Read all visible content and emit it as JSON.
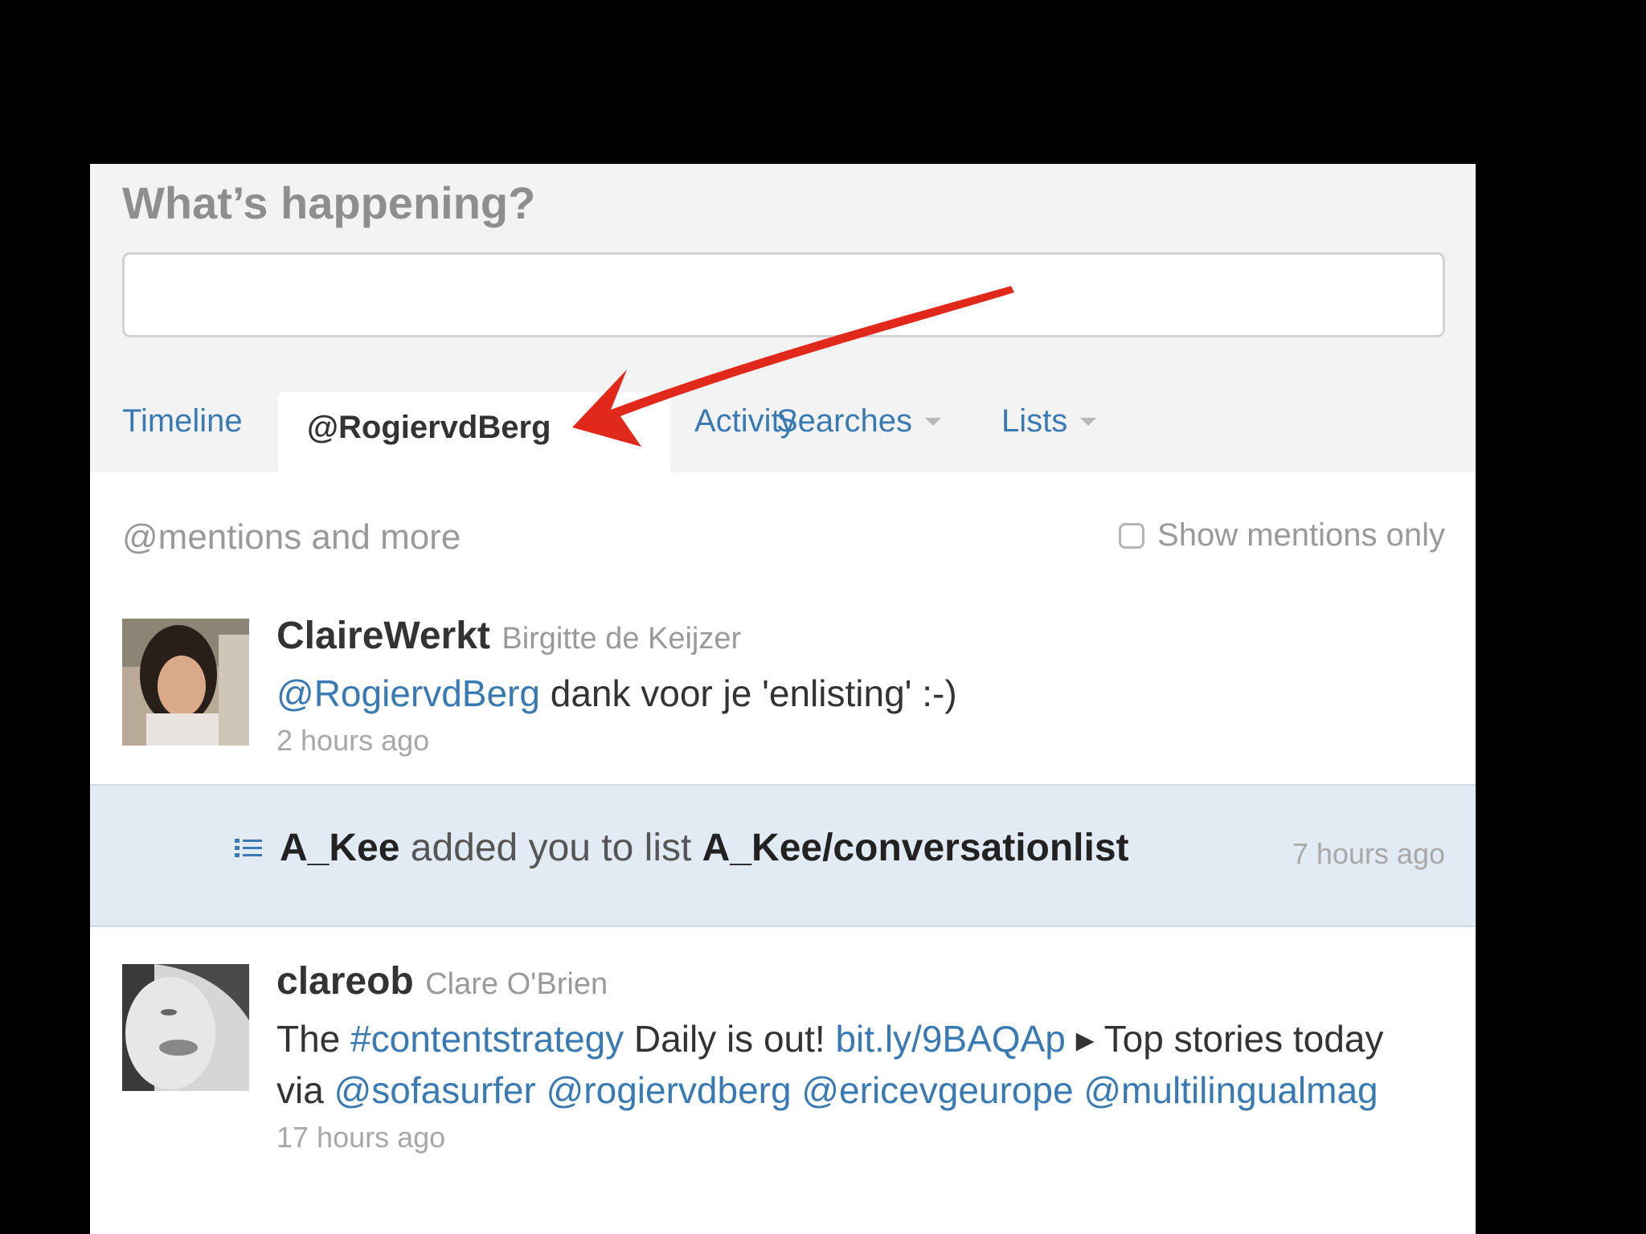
{
  "composer": {
    "title": "What’s happening?",
    "input_value": ""
  },
  "tabs": [
    {
      "label": "Timeline",
      "active": false
    },
    {
      "label": "@RogiervdBerg",
      "active": true
    },
    {
      "label": "Activity",
      "active": false
    },
    {
      "label": "Searches",
      "active": false,
      "dropdown": true
    },
    {
      "label": "Lists",
      "active": false,
      "dropdown": true
    }
  ],
  "mentions": {
    "header": "@mentions and more",
    "show_mentions_only_label": "Show mentions only",
    "show_mentions_only_checked": false
  },
  "tweets": [
    {
      "screen_name": "ClaireWerkt",
      "full_name": "Birgitte de Keijzer",
      "mention": "@RogiervdBerg",
      "text": " dank voor je 'enlisting' :-)",
      "time": "2 hours ago"
    },
    {
      "screen_name": "clareob",
      "full_name": "Clare O'Brien",
      "text_parts": {
        "t1": "The ",
        "hashtag": "#contentstrategy",
        "t2": " Daily is out! ",
        "url": "bit.ly/9BAQAp",
        "t3": " ▸ Top stories today via ",
        "m1": "@sofasurfer",
        "m2": "@rogiervdberg",
        "m3": "@ericevgeurope",
        "m4": "@multilingualmag"
      },
      "time": "17 hours ago"
    }
  ],
  "list_notice": {
    "user": "A_Kee",
    "middle": " added you to list ",
    "list": "A_Kee/conversationlist",
    "time": "7 hours ago",
    "icon": "list-icon"
  },
  "annotation": {
    "arrow_color": "#e0281b",
    "icon": "red-arrow"
  },
  "colors": {
    "link": "#3a7ab3",
    "notice_bg": "#e2ebf3"
  }
}
